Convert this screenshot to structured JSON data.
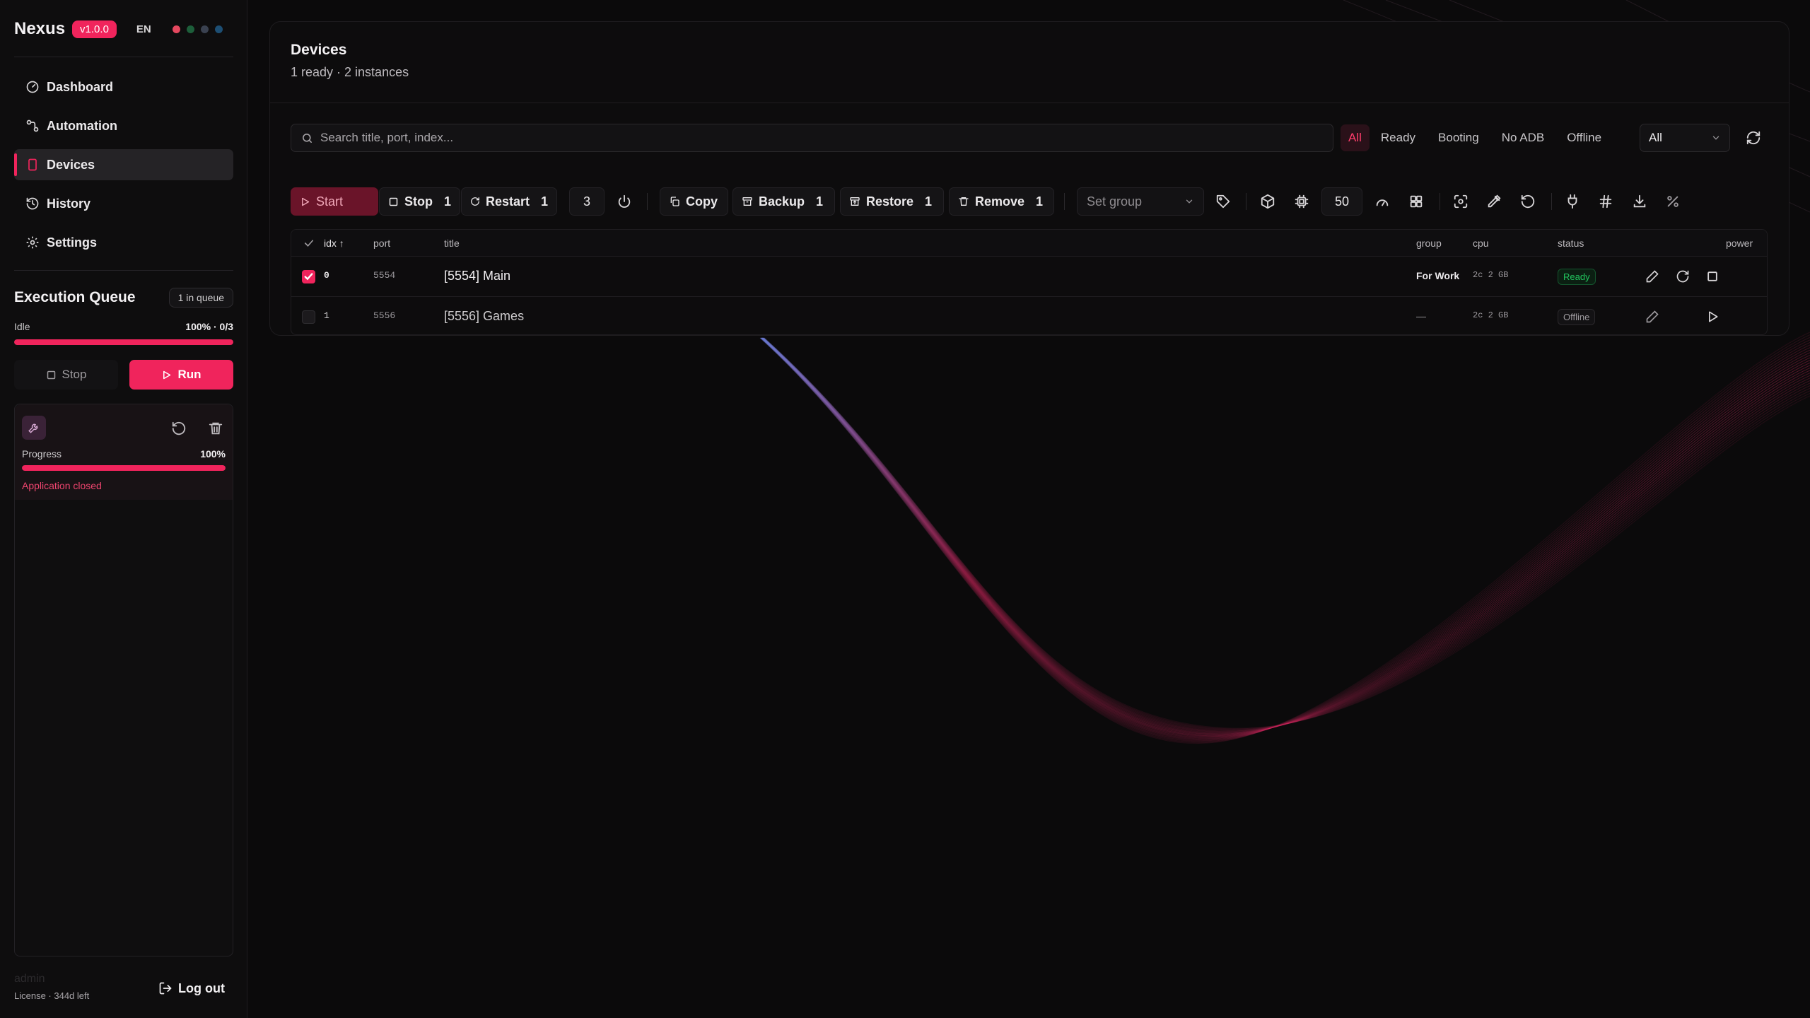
{
  "app": {
    "name": "Nexus",
    "version": "v1.0.0",
    "lang": "EN",
    "theme_dots": [
      "#e5485f",
      "#1d5e3a",
      "#3a4150",
      "#1d4e73"
    ]
  },
  "nav": {
    "items": [
      {
        "label": "Dashboard",
        "icon": "gauge-icon"
      },
      {
        "label": "Automation",
        "icon": "workflow-icon"
      },
      {
        "label": "Devices",
        "icon": "device-icon",
        "active": true
      },
      {
        "label": "History",
        "icon": "history-icon"
      },
      {
        "label": "Settings",
        "icon": "gear-icon"
      }
    ]
  },
  "queue": {
    "title": "Execution Queue",
    "badge": "1 in queue",
    "state": "Idle",
    "summary": "100% · 0/3",
    "progress": 1.0,
    "stop_label": "Stop",
    "run_label": "Run",
    "job": {
      "progress_label": "Progress",
      "progress_text": "100%",
      "progress": 1.0,
      "message": "Application closed"
    }
  },
  "footer": {
    "user": "admin",
    "license": "License · 344d left",
    "logout_label": "Log out"
  },
  "devices": {
    "title": "Devices",
    "subtitle": "1 ready · 2 instances",
    "search_placeholder": "Search title, port, index...",
    "filters": [
      "All",
      "Ready",
      "Booting",
      "No ADB",
      "Offline"
    ],
    "active_filter": "All",
    "select_value": "All",
    "toolbar": {
      "start_label": "Start",
      "stop_label": "Stop",
      "stop_count": "1",
      "restart_label": "Restart",
      "restart_count": "1",
      "batch_value": "3",
      "copy_label": "Copy",
      "backup_label": "Backup",
      "backup_count": "1",
      "restore_label": "Restore",
      "restore_count": "1",
      "remove_label": "Remove",
      "remove_count": "1",
      "group_placeholder": "Set group",
      "size_value": "50"
    },
    "columns": {
      "idx": "idx ↑",
      "port": "port",
      "title": "title",
      "group": "group",
      "cpu": "cpu",
      "status": "status",
      "power": "power"
    },
    "rows": [
      {
        "idx": "0",
        "port": "5554",
        "title": "[5554] Main",
        "group": "For Work",
        "cpu": "2c 2 GB",
        "status": "Ready",
        "checked": true
      },
      {
        "idx": "1",
        "port": "5556",
        "title": "[5556] Games",
        "group": "—",
        "cpu": "2c 2 GB",
        "status": "Offline",
        "checked": false
      }
    ]
  },
  "colors": {
    "accent": "#f0245c",
    "ready": "#22c55e",
    "background": "#0b0a0b"
  }
}
